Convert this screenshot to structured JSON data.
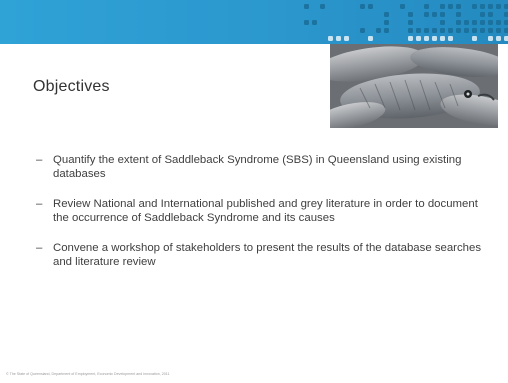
{
  "slide": {
    "title": "Objectives",
    "bullets": [
      {
        "dash": "–",
        "text": "Quantify the extent of Saddleback Syndrome (SBS) in Queensland using existing databases"
      },
      {
        "dash": "–",
        "text": "Review National and International published and grey literature in order to document the occurrence of Saddleback Syndrome and its causes"
      },
      {
        "dash": "–",
        "text": "Convene a workshop of stakeholders to present the results of the database searches and literature review"
      }
    ],
    "footer": "© The State of Queensland, Department of Employment, Economic Development and Innovation, 2011"
  },
  "colors": {
    "header_band": "#2b97cd",
    "dots": "#1b6f9a",
    "title_text": "#333333",
    "body_text": "#3f3f3f"
  },
  "images": {
    "header_image": "fish-photo"
  }
}
